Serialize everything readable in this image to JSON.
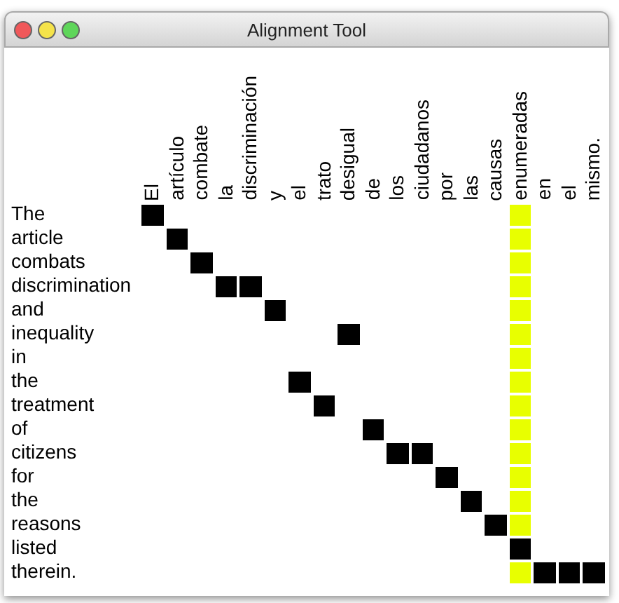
{
  "window": {
    "title": "Alignment Tool"
  },
  "columns": [
    {
      "label": "El",
      "selected": false
    },
    {
      "label": "artículo",
      "selected": false
    },
    {
      "label": "combate",
      "selected": false
    },
    {
      "label": "la",
      "selected": false
    },
    {
      "label": "discriminación",
      "selected": false
    },
    {
      "label": "y",
      "selected": false
    },
    {
      "label": "el",
      "selected": false
    },
    {
      "label": "trato",
      "selected": false
    },
    {
      "label": "desigual",
      "selected": false
    },
    {
      "label": "de",
      "selected": false
    },
    {
      "label": "los",
      "selected": false
    },
    {
      "label": "ciudadanos",
      "selected": false
    },
    {
      "label": "por",
      "selected": false
    },
    {
      "label": "las",
      "selected": false
    },
    {
      "label": "causas",
      "selected": false
    },
    {
      "label": "enumeradas",
      "selected": true
    },
    {
      "label": "en",
      "selected": false
    },
    {
      "label": "el",
      "selected": false
    },
    {
      "label": "mismo.",
      "selected": false
    }
  ],
  "rows": [
    {
      "label": "The",
      "aligned": [
        true,
        false,
        false,
        false,
        false,
        false,
        false,
        false,
        false,
        false,
        false,
        false,
        false,
        false,
        false,
        false,
        false,
        false,
        false
      ]
    },
    {
      "label": "article",
      "aligned": [
        false,
        true,
        false,
        false,
        false,
        false,
        false,
        false,
        false,
        false,
        false,
        false,
        false,
        false,
        false,
        false,
        false,
        false,
        false
      ]
    },
    {
      "label": "combats",
      "aligned": [
        false,
        false,
        true,
        false,
        false,
        false,
        false,
        false,
        false,
        false,
        false,
        false,
        false,
        false,
        false,
        false,
        false,
        false,
        false
      ]
    },
    {
      "label": "discrimination",
      "aligned": [
        false,
        false,
        false,
        true,
        true,
        false,
        false,
        false,
        false,
        false,
        false,
        false,
        false,
        false,
        false,
        false,
        false,
        false,
        false
      ]
    },
    {
      "label": "and",
      "aligned": [
        false,
        false,
        false,
        false,
        false,
        true,
        false,
        false,
        false,
        false,
        false,
        false,
        false,
        false,
        false,
        false,
        false,
        false,
        false
      ]
    },
    {
      "label": "inequality",
      "aligned": [
        false,
        false,
        false,
        false,
        false,
        false,
        false,
        false,
        true,
        false,
        false,
        false,
        false,
        false,
        false,
        false,
        false,
        false,
        false
      ]
    },
    {
      "label": "in",
      "aligned": [
        false,
        false,
        false,
        false,
        false,
        false,
        false,
        false,
        false,
        false,
        false,
        false,
        false,
        false,
        false,
        false,
        false,
        false,
        false
      ]
    },
    {
      "label": "the",
      "aligned": [
        false,
        false,
        false,
        false,
        false,
        false,
        true,
        false,
        false,
        false,
        false,
        false,
        false,
        false,
        false,
        false,
        false,
        false,
        false
      ]
    },
    {
      "label": "treatment",
      "aligned": [
        false,
        false,
        false,
        false,
        false,
        false,
        false,
        true,
        false,
        false,
        false,
        false,
        false,
        false,
        false,
        false,
        false,
        false,
        false
      ]
    },
    {
      "label": "of",
      "aligned": [
        false,
        false,
        false,
        false,
        false,
        false,
        false,
        false,
        false,
        true,
        false,
        false,
        false,
        false,
        false,
        false,
        false,
        false,
        false
      ]
    },
    {
      "label": "citizens",
      "aligned": [
        false,
        false,
        false,
        false,
        false,
        false,
        false,
        false,
        false,
        false,
        true,
        true,
        false,
        false,
        false,
        false,
        false,
        false,
        false
      ]
    },
    {
      "label": "for",
      "aligned": [
        false,
        false,
        false,
        false,
        false,
        false,
        false,
        false,
        false,
        false,
        false,
        false,
        true,
        false,
        false,
        false,
        false,
        false,
        false
      ]
    },
    {
      "label": "the",
      "aligned": [
        false,
        false,
        false,
        false,
        false,
        false,
        false,
        false,
        false,
        false,
        false,
        false,
        false,
        true,
        false,
        false,
        false,
        false,
        false
      ]
    },
    {
      "label": "reasons",
      "aligned": [
        false,
        false,
        false,
        false,
        false,
        false,
        false,
        false,
        false,
        false,
        false,
        false,
        false,
        false,
        true,
        false,
        false,
        false,
        false
      ]
    },
    {
      "label": "listed",
      "aligned": [
        false,
        false,
        false,
        false,
        false,
        false,
        false,
        false,
        false,
        false,
        false,
        false,
        false,
        false,
        false,
        true,
        false,
        false,
        false
      ]
    },
    {
      "label": "therein.",
      "aligned": [
        false,
        false,
        false,
        false,
        false,
        false,
        false,
        false,
        false,
        false,
        false,
        false,
        false,
        false,
        false,
        false,
        true,
        true,
        true
      ]
    }
  ]
}
